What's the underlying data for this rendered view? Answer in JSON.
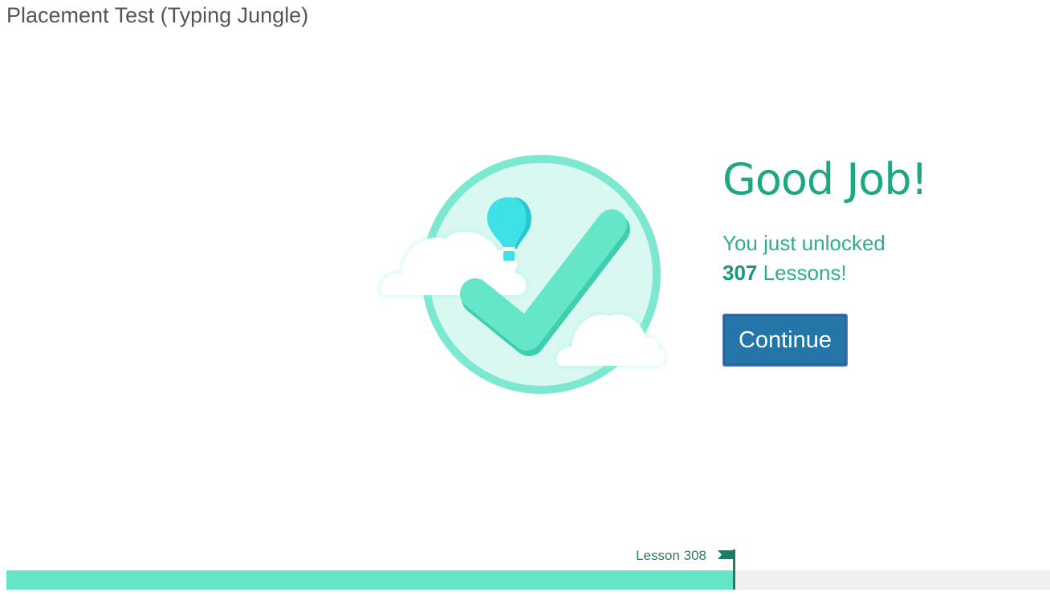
{
  "window": {
    "title": "Placement Test (Typing Jungle)"
  },
  "result": {
    "headline": "Good Job!",
    "message_line1": "You just unlocked",
    "unlocked_count": "307",
    "message_line2_suffix": " Lessons!",
    "continue_label": "Continue"
  },
  "progress": {
    "lesson_label": "Lesson 308",
    "fraction": 0.698
  },
  "colors": {
    "accent": "#1fa784",
    "button": "#2475a8",
    "progress_fill": "#63e5c7",
    "progress_track": "#f0f0f0",
    "flag": "#1f7a68"
  },
  "icons": {
    "illustration": "checkmark-badge-with-balloon-and-clouds",
    "progress_marker": "flag-icon"
  }
}
